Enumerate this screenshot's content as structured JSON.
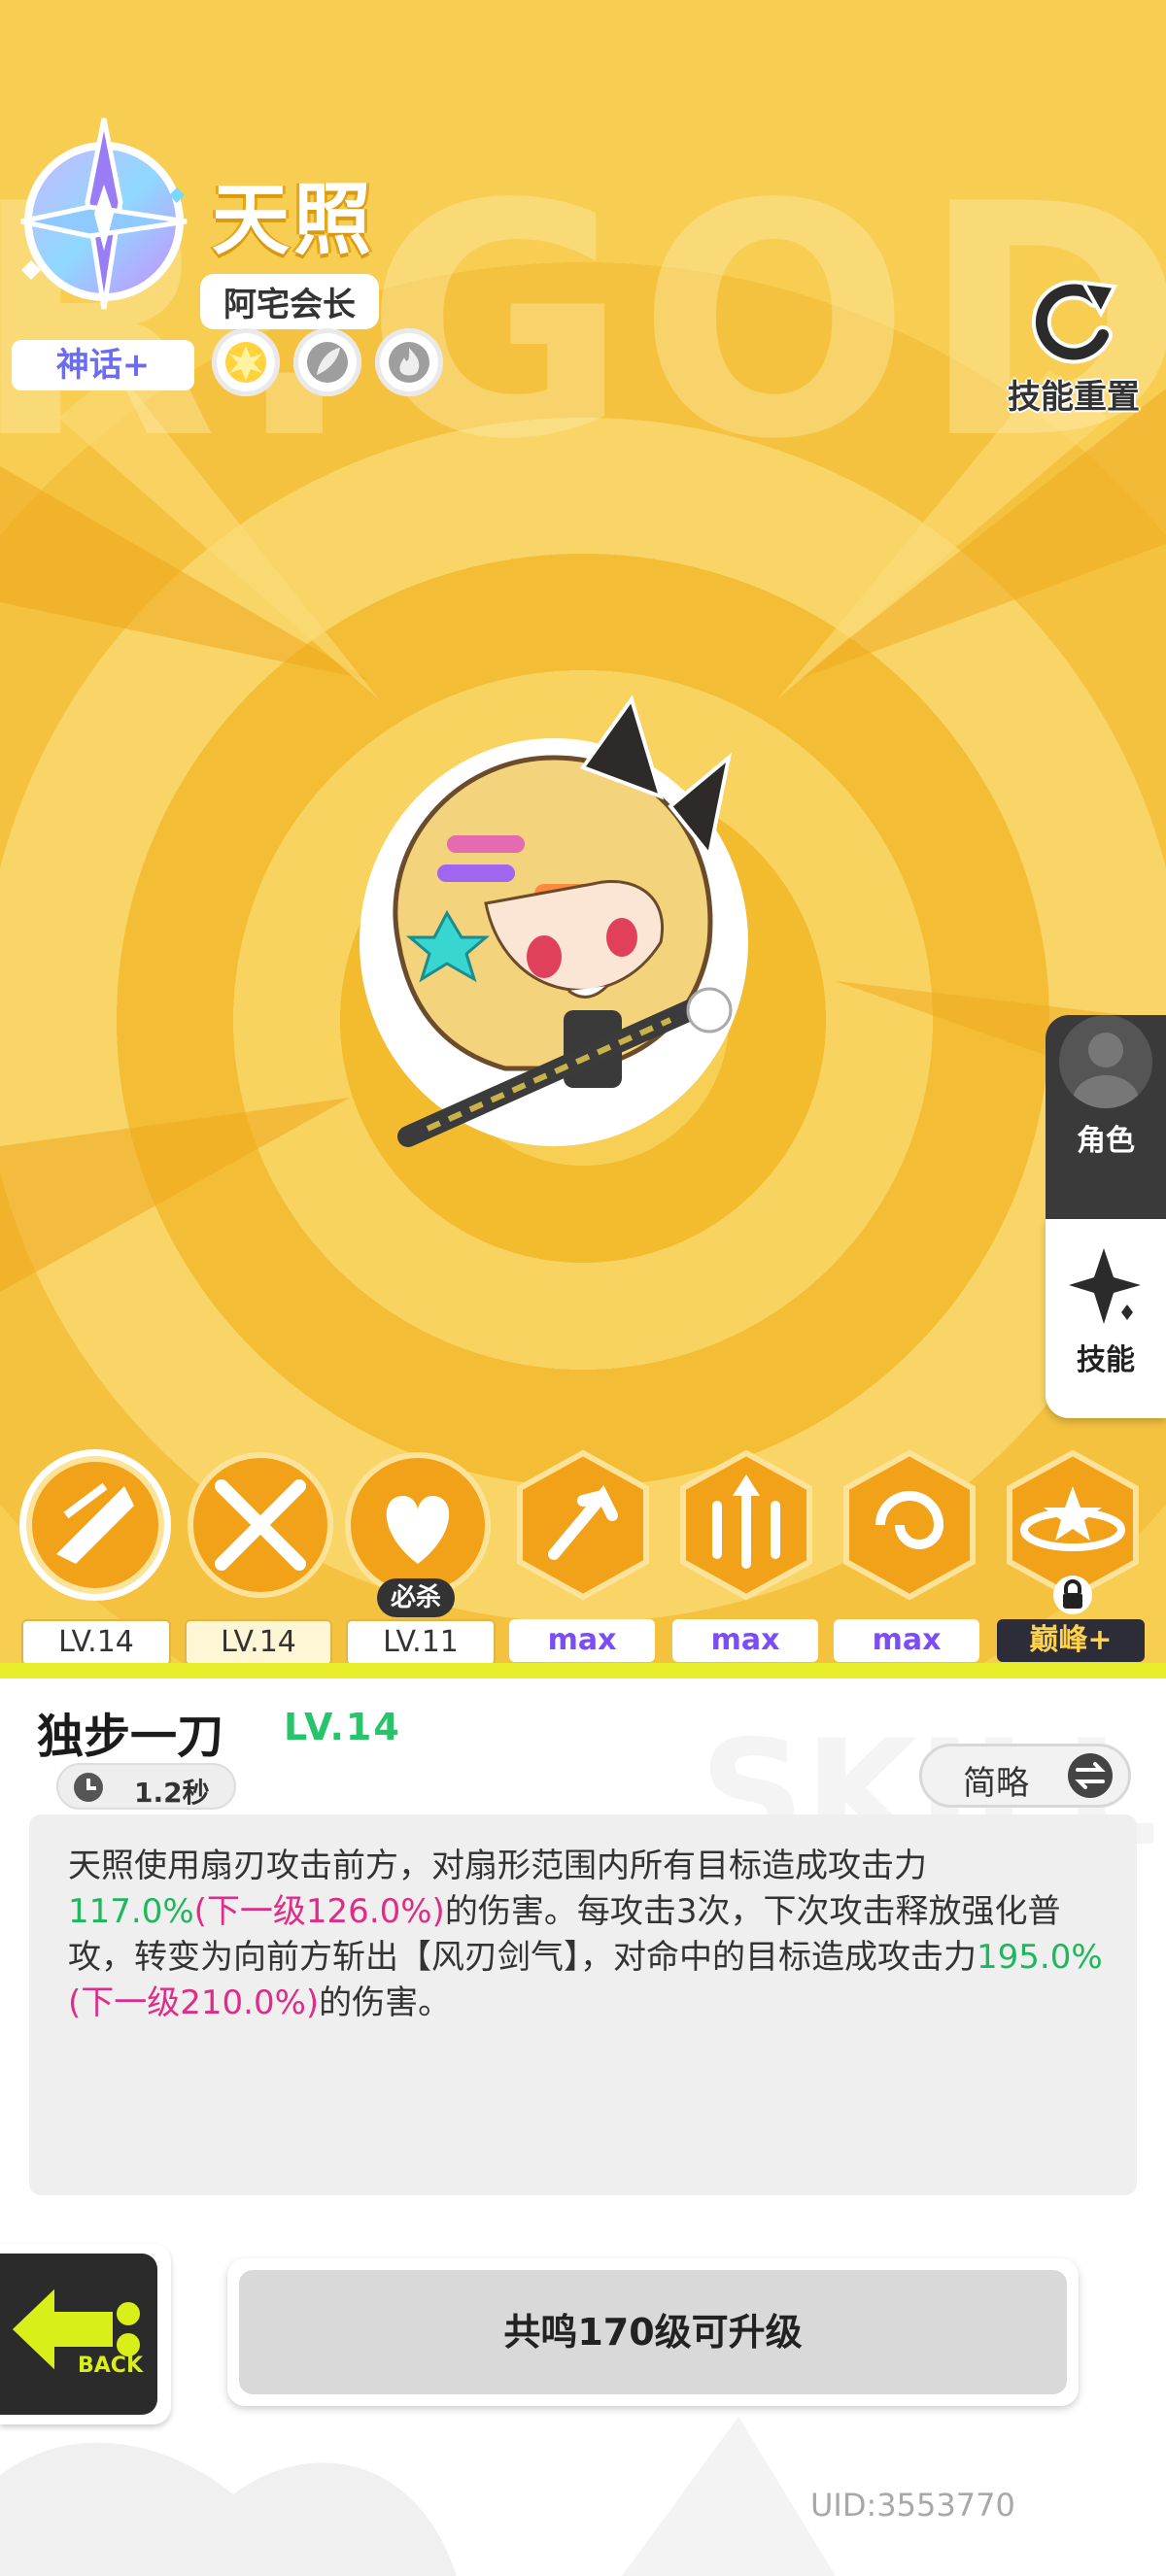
{
  "hero": {
    "name": "天照",
    "title": "阿宅会长",
    "rarity": "神话+",
    "traits": [
      "burst-icon",
      "feather-icon",
      "fire-icon"
    ],
    "background_text": "R.GOD",
    "reset_label": "技能重置"
  },
  "side_tabs": {
    "role_label": "角色",
    "skill_label": "技能"
  },
  "skills": [
    {
      "icon": "fan-slash-icon",
      "tag": "LV.14"
    },
    {
      "icon": "crossed-blades-icon",
      "tag": "LV.14"
    },
    {
      "icon": "heart-wings-icon",
      "tag": "LV.11",
      "badge": "必杀"
    },
    {
      "icon": "arrow-burst-icon",
      "tag": "max"
    },
    {
      "icon": "triple-arrow-icon",
      "tag": "max"
    },
    {
      "icon": "swirl-icon",
      "tag": "max"
    },
    {
      "icon": "star-orbit-icon",
      "tag": "巅峰+",
      "locked": true
    }
  ],
  "detail": {
    "name": "独步一刀",
    "level": "LV.14",
    "cooldown": "1.2秒",
    "brief_label": "简略",
    "desc_1": "天照使用扇刃攻击前方，对扇形范围内所有目标造成攻击力",
    "val_1": "117.0%",
    "next_1": "(下一级126.0%)",
    "desc_2": "的伤害。每攻击3次，下次攻击释放强化普攻，转变为向前方斩出【风刃剑气】，对命中的目标造成攻击力",
    "val_2": "195.0%",
    "next_2": "(下一级210.0%)",
    "desc_3": "的伤害。"
  },
  "back_label": "BACK",
  "upgrade_label": "共鸣170级可升级",
  "uid": "UID:3553770",
  "colors": {
    "accent_yellow": "#f5c53b",
    "level_green": "#28c46a",
    "next_pink": "#e02b87",
    "max_purple": "#7b4cf7"
  }
}
